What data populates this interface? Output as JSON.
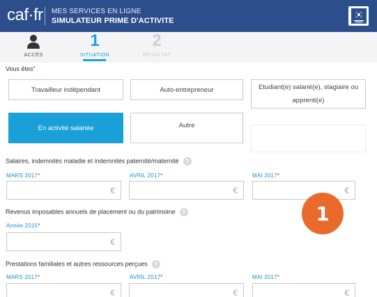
{
  "header": {
    "logo": "caf·fr",
    "line1": "MES SERVICES EN LIGNE",
    "line2": "SIMULATEUR PRIME D'ACTIVITE"
  },
  "steps": [
    {
      "num": "",
      "label": "ACCÈS",
      "state": "done"
    },
    {
      "num": "1",
      "label": "SITUATION",
      "state": "active"
    },
    {
      "num": "2",
      "label": "RÉSULTAT",
      "state": "disabled"
    }
  ],
  "vous_etes": {
    "label": "Vous êtes",
    "options": [
      {
        "label": "Travailleur indépendant",
        "selected": false
      },
      {
        "label": "Auto-entrepreneur",
        "selected": false
      },
      {
        "label": "Etudiant(e) salarié(e), stagiaire ou apprenti(e)",
        "selected": false
      },
      {
        "label": "En activité salariée",
        "selected": true
      },
      {
        "label": "Autre",
        "selected": false
      }
    ]
  },
  "salaires": {
    "label": "Salaires, indemnités maladie et indemnités paternité/maternité",
    "months": [
      "MARS 2017",
      "AVRIL 2017",
      "MAI 2017"
    ],
    "currency": "€"
  },
  "revenus": {
    "label": "Revenus imposables annuels de placement ou du patrimoine",
    "year": "Année 2015",
    "currency": "€"
  },
  "prestations": {
    "label": "Prestations familiales et autres ressources perçues",
    "months": [
      "MARS 2017",
      "AVRIL 2017",
      "MAI 2017"
    ],
    "currency": "€"
  },
  "overlay_badge": "1",
  "colors": {
    "header_bg": "#2c4f8c",
    "accent": "#1da1e2",
    "selected_bg": "#1a9fd8",
    "badge": "#ea6a2c",
    "required": "#e2231a"
  }
}
